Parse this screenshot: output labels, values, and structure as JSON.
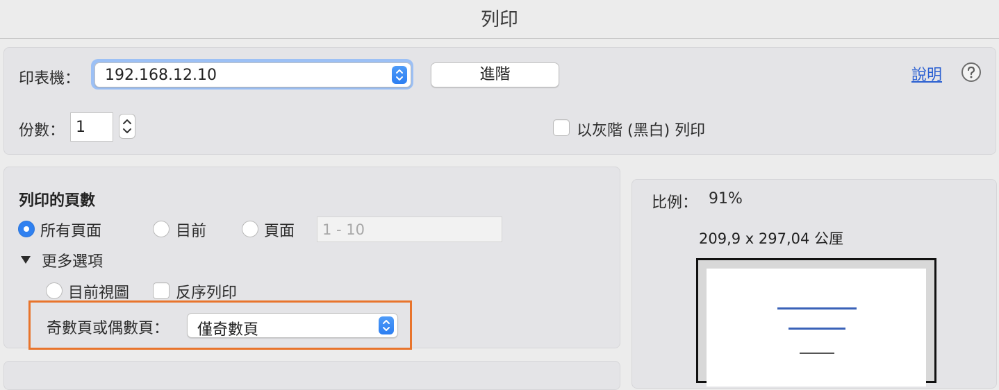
{
  "window": {
    "title": "列印"
  },
  "printer": {
    "label": "印表機：",
    "selected": "192.168.12.10",
    "advanced_label": "進階",
    "help_link": "說明",
    "help_icon": "question-circle-icon"
  },
  "copies": {
    "label": "份數：",
    "value": "1"
  },
  "grayscale": {
    "label": "以灰階 (黑白) 列印",
    "checked": false
  },
  "pages": {
    "heading": "列印的頁數",
    "options": [
      {
        "label": "所有頁面",
        "selected": true
      },
      {
        "label": "目前",
        "selected": false
      },
      {
        "label": "頁面",
        "selected": false
      }
    ],
    "range_placeholder": "1 - 10",
    "more_options_label": "更多選項",
    "current_view_label": "目前視圖",
    "reverse_label": "反序列印",
    "odd_even_label": "奇數頁或偶數頁：",
    "odd_even_selected": "僅奇數頁"
  },
  "preview": {
    "scale_label": "比例：",
    "scale_value": "91%",
    "size_text": "209,9 x 297,04 公厘"
  },
  "colors": {
    "highlight": "#e8742c",
    "accent": "#2f80f0",
    "link": "#2a5fd1"
  }
}
